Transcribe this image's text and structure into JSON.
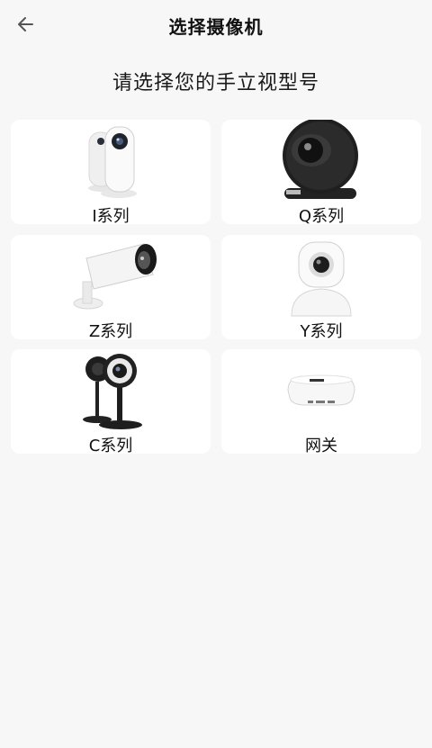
{
  "header": {
    "title": "选择摄像机",
    "back_icon": "arrow-left-icon"
  },
  "prompt": "请选择您的手立视型号",
  "models": [
    {
      "label": "I系列",
      "icon": "i-series-camera-icon"
    },
    {
      "label": "Q系列",
      "icon": "q-series-camera-icon"
    },
    {
      "label": "Z系列",
      "icon": "z-series-camera-icon"
    },
    {
      "label": "Y系列",
      "icon": "y-series-camera-icon"
    },
    {
      "label": "C系列",
      "icon": "c-series-camera-icon"
    },
    {
      "label": "网关",
      "icon": "gateway-icon"
    }
  ]
}
